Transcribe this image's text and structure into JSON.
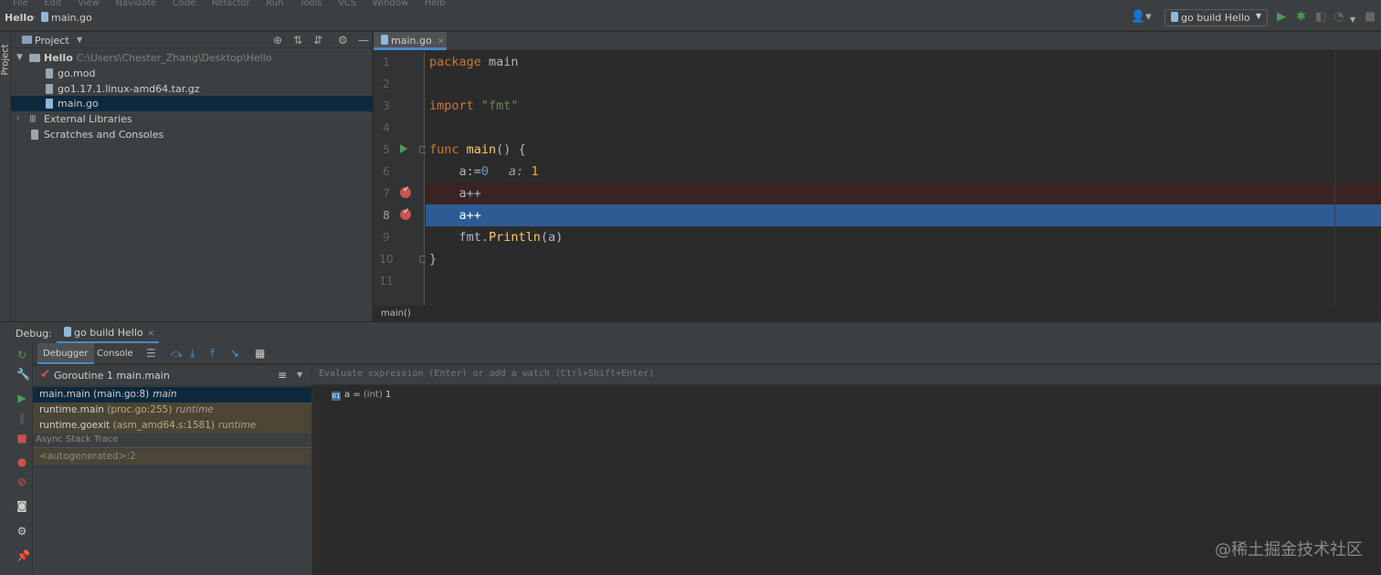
{
  "menu": {
    "items": [
      "File",
      "Edit",
      "View",
      "Navigate",
      "Code",
      "Refactor",
      "Run",
      "Tools",
      "VCS",
      "Window",
      "Help"
    ]
  },
  "navbar": {
    "project": "Hello",
    "file": "main.go",
    "run_config": "go build Hello"
  },
  "left_stripe": {
    "label": "Project"
  },
  "project_panel": {
    "title": "Project",
    "tree": [
      {
        "label": "Hello",
        "path": "C:\\Users\\Chester_Zhang\\Desktop\\Hello"
      },
      {
        "label": "go.mod"
      },
      {
        "label": "go1.17.1.linux-amd64.tar.gz"
      },
      {
        "label": "main.go"
      },
      {
        "label": "External Libraries"
      },
      {
        "label": "Scratches and Consoles"
      }
    ]
  },
  "editor": {
    "tab": "main.go",
    "line_numbers": [
      "1",
      "2",
      "3",
      "4",
      "5",
      "6",
      "7",
      "8",
      "9",
      "10",
      "11"
    ],
    "code": {
      "l1_kw": "package",
      "l1_rest": " main",
      "l3_kw": "import",
      "l3_str": "\"fmt\"",
      "l5_kw": "func",
      "l5_fn": "main",
      "l5_rest": "() {",
      "l6_code": "    a:=",
      "l6_num": "0",
      "l6_hint": "a:",
      "l6_hint_val": "1",
      "l7_code": "    a++",
      "l8_code": "    a++",
      "l9_pkg": "    fmt.",
      "l9_fn": "Println",
      "l9_rest": "(a)",
      "l10_code": "}"
    },
    "breadcrumb": "main()"
  },
  "debug": {
    "label": "Debug:",
    "session_tab": "go build Hello",
    "tabs": {
      "debugger": "Debugger",
      "console": "Console"
    },
    "goroutine": "Goroutine 1 main.main",
    "frames": [
      {
        "func": "main.main",
        "loc": "(main.go:8)",
        "pkg": "main"
      },
      {
        "func": "runtime.main",
        "loc": "(proc.go:255)",
        "pkg": "runtime"
      },
      {
        "func": "runtime.goexit",
        "loc": "(asm_amd64.s:1581)",
        "pkg": "runtime"
      }
    ],
    "async_label": "Async Stack Trace",
    "autogen": "<autogenerated>:2",
    "eval_placeholder": "Evaluate expression (Enter) or add a watch (Ctrl+Shift+Enter)",
    "variable": {
      "icon": "01",
      "name": "a",
      "eq": " = ",
      "type": "(int)",
      "value": " 1"
    }
  },
  "watermark": "@稀土掘金技术社区",
  "colors": {
    "accent": "#4a88c7",
    "exec_line": "#2d5c94",
    "breakpoint": "#c75450",
    "run": "#499c54"
  }
}
